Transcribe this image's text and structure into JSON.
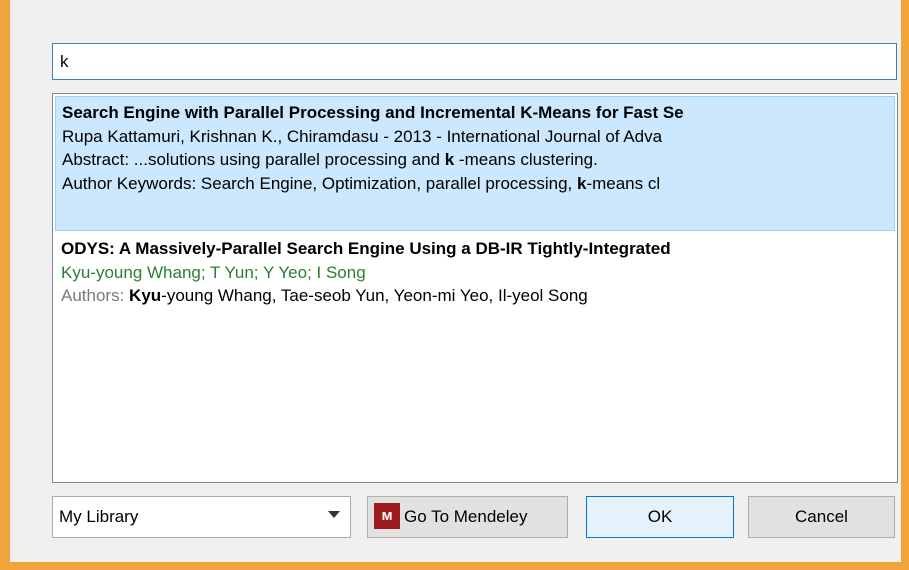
{
  "search": {
    "value": "k"
  },
  "results": [
    {
      "title": "Search Engine with Parallel Processing and Incremental K-Means for Fast Se",
      "meta": "Rupa Kattamuri, Krishnan K., Chiramdasu - 2013 - International Journal of Adva",
      "abstract_prefix": "Abstract: ...solutions using parallel processing and ",
      "abstract_highlight": "k",
      "abstract_suffix": " -means clustering.",
      "keywords_prefix": "Author Keywords: Search Engine, Optimization, parallel processing, ",
      "keywords_highlight": "k",
      "keywords_suffix": "-means cl"
    },
    {
      "title": "ODYS: A Massively-Parallel Search Engine Using a DB-IR Tightly-Integrated",
      "authors_short": "Kyu-young Whang; T Yun; Y Yeo; I Song",
      "authors_label": "Authors: ",
      "authors_highlight": "Kyu",
      "authors_rest": "-young Whang, Tae-seob Yun, Yeon-mi Yeo, Il-yeol Song"
    }
  ],
  "bottom": {
    "library": "My Library",
    "go_to_mendeley": "Go To Mendeley",
    "ok": "OK",
    "cancel": "Cancel"
  },
  "icons": {
    "mendeley": "mendeley-logo-icon",
    "dropdown": "dropdown-arrow-icon"
  },
  "colors": {
    "frame": "#f0a43c",
    "selection": "#cce8ff",
    "green_text": "#2e7d32"
  }
}
